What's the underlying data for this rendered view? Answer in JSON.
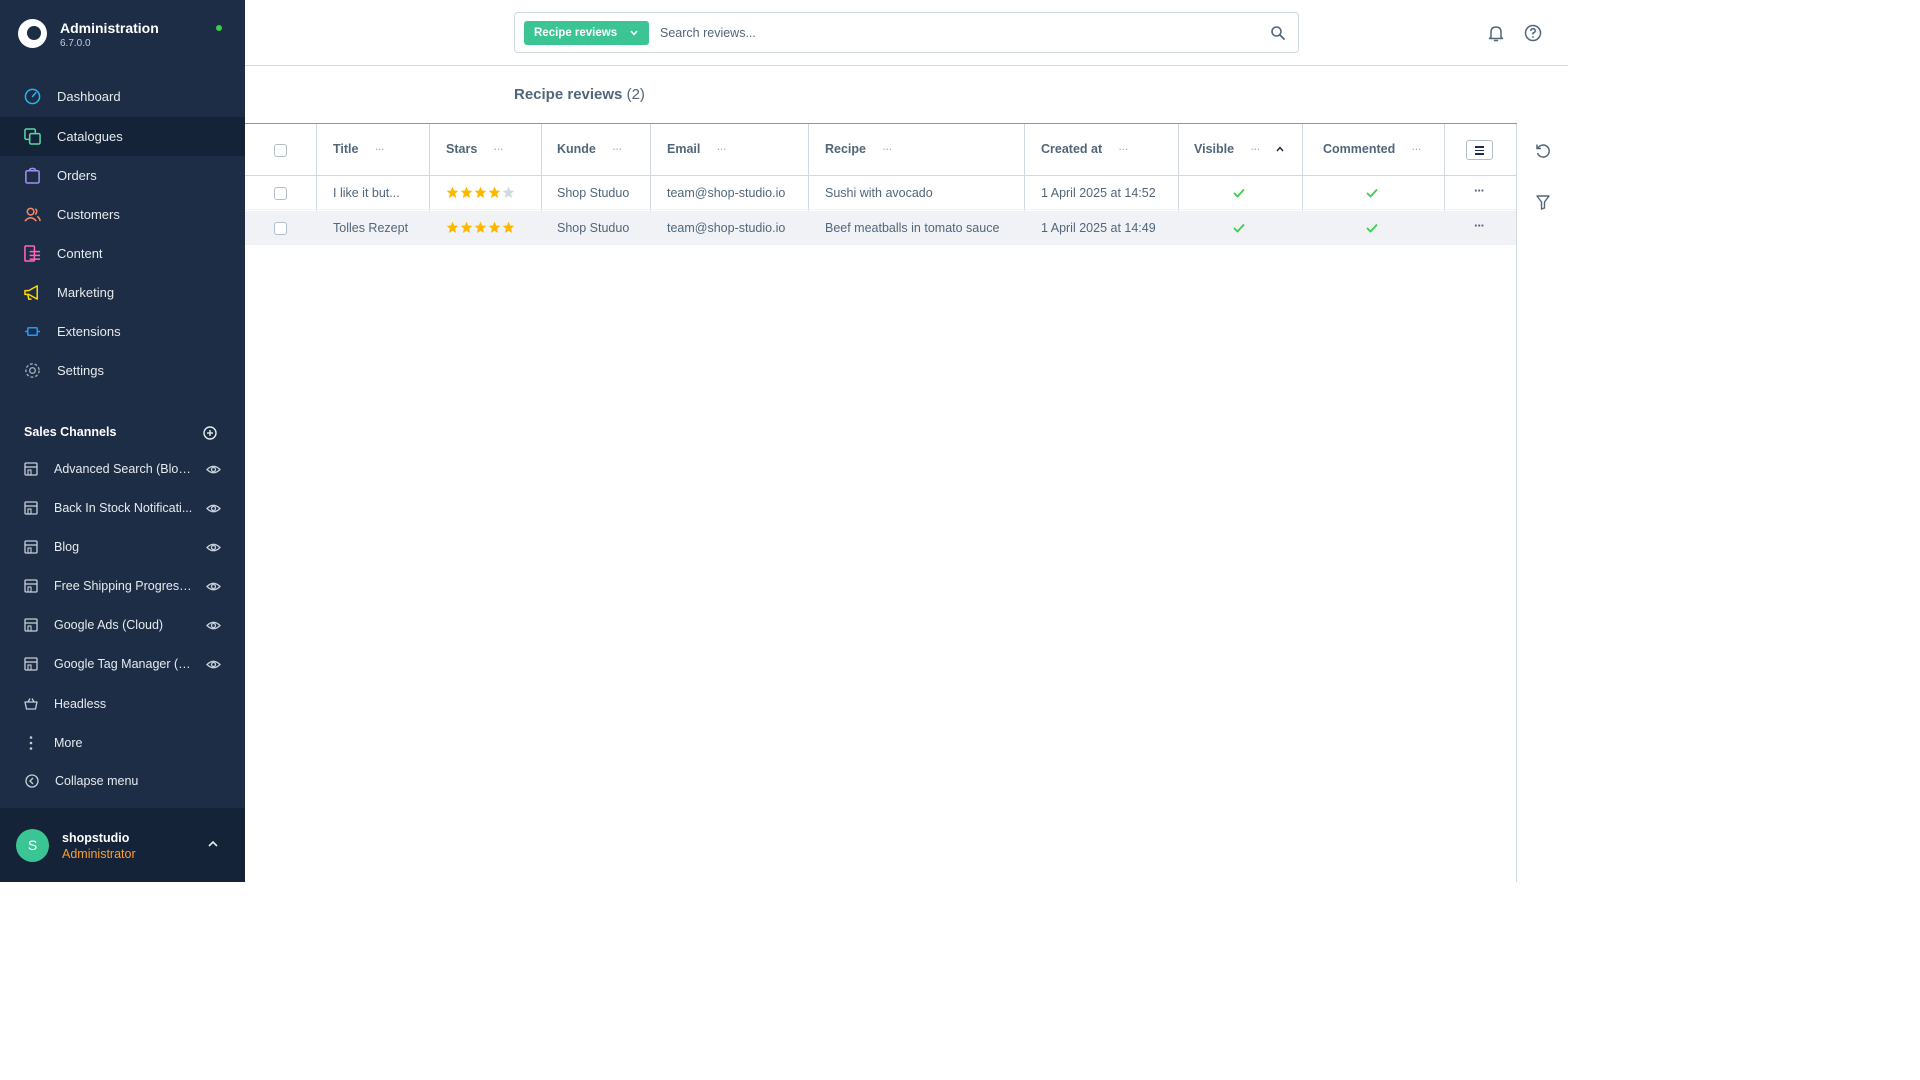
{
  "brand": {
    "title": "Administration",
    "version": "6.7.0.0"
  },
  "nav": {
    "items": [
      {
        "label": "Dashboard",
        "icon": "dashboard-icon",
        "color": "#27b6f5"
      },
      {
        "label": "Catalogues",
        "icon": "catalogues-icon",
        "color": "#57d9a3"
      },
      {
        "label": "Orders",
        "icon": "orders-icon",
        "color": "#a092f0"
      },
      {
        "label": "Customers",
        "icon": "customers-icon",
        "color": "#f88962"
      },
      {
        "label": "Content",
        "icon": "content-icon",
        "color": "#ff68b4"
      },
      {
        "label": "Marketing",
        "icon": "marketing-icon",
        "color": "#ffd700"
      },
      {
        "label": "Extensions",
        "icon": "extensions-icon",
        "color": "#189eff"
      },
      {
        "label": "Settings",
        "icon": "settings-icon",
        "color": "#9aa8b5"
      }
    ],
    "active": "Catalogues"
  },
  "sales_channels": {
    "heading": "Sales Channels",
    "items": [
      {
        "label": "Advanced Search (Blog ..."
      },
      {
        "label": "Back In Stock Notificati..."
      },
      {
        "label": "Blog"
      },
      {
        "label": "Free Shipping Progress ..."
      },
      {
        "label": "Google Ads (Cloud)"
      },
      {
        "label": "Google Tag Manager (C..."
      },
      {
        "label": "Headless"
      }
    ],
    "more_label": "More",
    "collapse_label": "Collapse menu"
  },
  "user": {
    "initial": "S",
    "name": "shopstudio",
    "role": "Administrator"
  },
  "search": {
    "type_label": "Recipe reviews",
    "placeholder": "Search reviews..."
  },
  "page": {
    "title": "Recipe reviews",
    "count": "(2)"
  },
  "grid": {
    "columns": [
      "Title",
      "Stars",
      "Kunde",
      "Email",
      "Recipe",
      "Created at",
      "Visible",
      "Commented"
    ],
    "sorted_column": "Visible",
    "sort_direction": "ascending",
    "rows": [
      {
        "title": "I like it but...",
        "stars": 4,
        "kunde": "Shop Studuo",
        "email": "team@shop-studio.io",
        "recipe": "Sushi with avocado",
        "created_at": "1 April 2025 at 14:52",
        "visible": true,
        "commented": true
      },
      {
        "title": "Tolles Rezept",
        "stars": 5,
        "kunde": "Shop Studuo",
        "email": "team@shop-studio.io",
        "recipe": "Beef meatballs in tomato sauce",
        "created_at": "1 April 2025 at 14:49",
        "visible": true,
        "commented": true
      }
    ]
  },
  "colors": {
    "sidebar_bg": "#1d2d45",
    "accent": "#3cc594",
    "star": "#ffb800",
    "check": "#37d046",
    "role": "#ff9e2c"
  }
}
